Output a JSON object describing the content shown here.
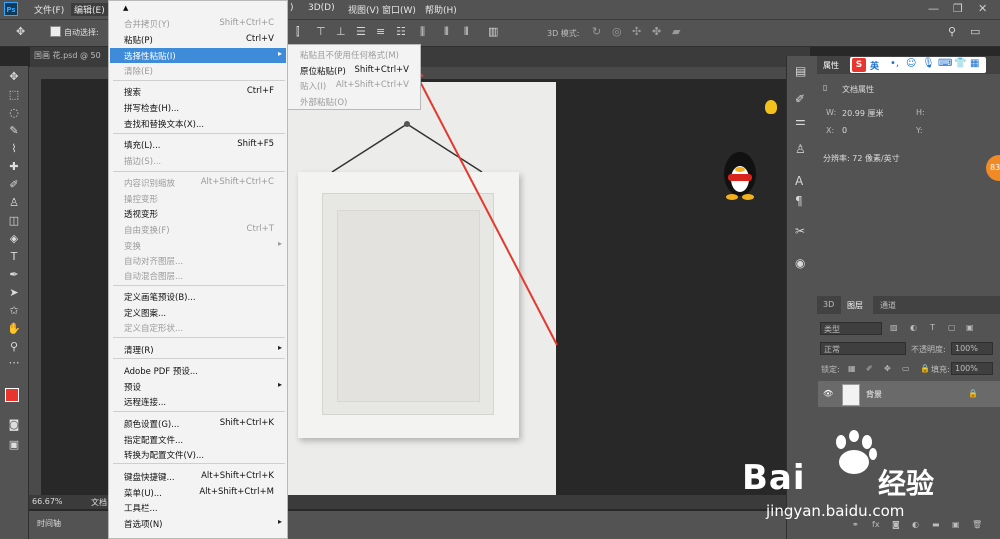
{
  "app": {
    "logo": "Ps"
  },
  "menubar": {
    "items": [
      "文件(F)",
      "编辑(E)",
      ")",
      "3D(D)",
      "视图(V)",
      "窗口(W)",
      "帮助(H)"
    ],
    "window_controls": [
      "minimize-icon",
      "restore-icon",
      "close-icon"
    ]
  },
  "options_bar": {
    "auto_select_label": "自动选择:",
    "mode_3d_label": "3D 模式:"
  },
  "document_tab": {
    "label": "国画 花.psd @ 50"
  },
  "status": {
    "zoom": "66.67%",
    "doc_label": "文档"
  },
  "timeline": {
    "label": "时间轴"
  },
  "edit_menu": {
    "rows": [
      {
        "label": "合并拷贝(Y)",
        "shortcut": "Shift+Ctrl+C",
        "disabled": true
      },
      {
        "label": "粘贴(P)",
        "shortcut": "Ctrl+V",
        "disabled": false
      },
      {
        "label": "选择性粘贴(I)",
        "shortcut": "",
        "disabled": false,
        "highlighted": true,
        "submenu": true
      },
      {
        "label": "清除(E)",
        "shortcut": "",
        "disabled": true
      },
      {
        "label": "搜索",
        "shortcut": "Ctrl+F",
        "disabled": false
      },
      {
        "label": "拼写检查(H)...",
        "shortcut": "",
        "disabled": false
      },
      {
        "label": "查找和替换文本(X)...",
        "shortcut": "",
        "disabled": false
      },
      {
        "label": "填充(L)...",
        "shortcut": "Shift+F5",
        "disabled": false
      },
      {
        "label": "描边(S)...",
        "shortcut": "",
        "disabled": true
      },
      {
        "label": "内容识别缩放",
        "shortcut": "Alt+Shift+Ctrl+C",
        "disabled": true
      },
      {
        "label": "操控变形",
        "shortcut": "",
        "disabled": true
      },
      {
        "label": "透视变形",
        "shortcut": "",
        "disabled": false
      },
      {
        "label": "自由变换(F)",
        "shortcut": "Ctrl+T",
        "disabled": true
      },
      {
        "label": "变换",
        "shortcut": "",
        "disabled": true,
        "submenu": true
      },
      {
        "label": "自动对齐图层...",
        "shortcut": "",
        "disabled": true
      },
      {
        "label": "自动混合图层...",
        "shortcut": "",
        "disabled": true
      },
      {
        "label": "定义画笔预设(B)...",
        "shortcut": "",
        "disabled": false
      },
      {
        "label": "定义图案...",
        "shortcut": "",
        "disabled": false
      },
      {
        "label": "定义自定形状...",
        "shortcut": "",
        "disabled": true
      },
      {
        "label": "清理(R)",
        "shortcut": "",
        "disabled": false,
        "submenu": true
      },
      {
        "label": "Adobe PDF 预设...",
        "shortcut": "",
        "disabled": false
      },
      {
        "label": "预设",
        "shortcut": "",
        "disabled": false,
        "submenu": true
      },
      {
        "label": "远程连接...",
        "shortcut": "",
        "disabled": false
      },
      {
        "label": "颜色设置(G)...",
        "shortcut": "Shift+Ctrl+K",
        "disabled": false
      },
      {
        "label": "指定配置文件...",
        "shortcut": "",
        "disabled": false
      },
      {
        "label": "转换为配置文件(V)...",
        "shortcut": "",
        "disabled": false
      },
      {
        "label": "键盘快捷键...",
        "shortcut": "Alt+Shift+Ctrl+K",
        "disabled": false
      },
      {
        "label": "菜单(U)...",
        "shortcut": "Alt+Shift+Ctrl+M",
        "disabled": false
      },
      {
        "label": "工具栏...",
        "shortcut": "",
        "disabled": false
      },
      {
        "label": "首选项(N)",
        "shortcut": "",
        "disabled": false,
        "submenu": true
      }
    ]
  },
  "paste_special_submenu": {
    "rows": [
      {
        "label": "粘贴且不使用任何格式(M)",
        "shortcut": "",
        "disabled": true
      },
      {
        "label": "原位粘贴(P)",
        "shortcut": "Shift+Ctrl+V",
        "disabled": false
      },
      {
        "label": "贴入(I)",
        "shortcut": "Alt+Shift+Ctrl+V",
        "disabled": true
      },
      {
        "label": "外部粘贴(O)",
        "shortcut": "",
        "disabled": true
      }
    ]
  },
  "properties_panel": {
    "tab": "属性",
    "section": "文档属性",
    "w_label": "W:",
    "w_value": "20.99 厘米",
    "h_label": "H:",
    "x_label": "X:",
    "x_value": "0",
    "y_label": "Y:",
    "resolution": "分辨率: 72 像素/英寸"
  },
  "ime_toolbar": {
    "s_badge": "S",
    "lang": "英"
  },
  "badge": {
    "value": "83"
  },
  "layers_panel": {
    "tabs": [
      "3D",
      "图层",
      "通道"
    ],
    "kind_label": "类型",
    "blend_mode": "正常",
    "opacity_label": "不透明度:",
    "opacity_value": "100%",
    "lock_label": "锁定:",
    "fill_label": "填充:",
    "fill_value": "100%",
    "layer_name": "背景"
  },
  "watermark": {
    "brand": "Bai",
    "cn": "经验",
    "url": "jingyan.baidu.com"
  },
  "colors": {
    "accent_highlight": "#3d8bd9",
    "arrow": "#e23a2e",
    "foreground": "#e8352e"
  }
}
